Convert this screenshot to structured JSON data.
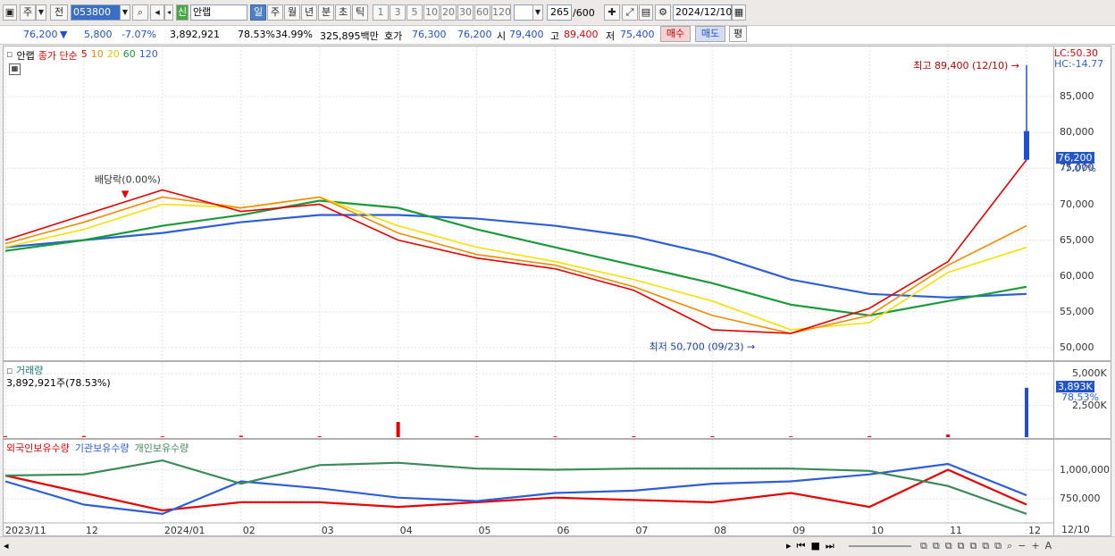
{
  "toolbar": {
    "market": "주",
    "mode": "전",
    "code": "053800",
    "badge": "신",
    "name": "안랩",
    "periods": [
      "일",
      "주",
      "월",
      "년",
      "분",
      "초",
      "틱"
    ],
    "selected_period": "일",
    "intervals": [
      "1",
      "3",
      "5",
      "10",
      "20",
      "30",
      "60",
      "120"
    ],
    "count": "265",
    "count_max": "/600",
    "date": "2024/12/10"
  },
  "quote": {
    "price": "76,200",
    "change": "5,800",
    "change_pct": "-7.07%",
    "volume": "3,892,921",
    "vol_ratio": "78.53%",
    "rate2": "34.99%",
    "amount": "325,895백만",
    "ask_label": "호가",
    "ask": "76,300",
    "bid": "76,200",
    "open_label": "시",
    "open": "79,400",
    "high_label": "고",
    "high": "89,400",
    "low_label": "저",
    "low": "75,400",
    "buy_button": "매수",
    "sell_button": "매도",
    "eval_button": "평"
  },
  "colors": {
    "up": "#e60000",
    "down": "#1f4fd6",
    "ma5": "#e60000",
    "ma10": "#f08c00",
    "ma20": "#f5e100",
    "ma60": "#1b9a3a",
    "ma120": "#2d5ed8",
    "foreign": "#e60000",
    "institution": "#2d5ed8",
    "individual": "#3a8a5a"
  },
  "price_panel": {
    "stock_label": "안랩",
    "legend_prefix": "종가 단순",
    "ma_labels": [
      "5",
      "10",
      "20",
      "60",
      "120"
    ],
    "high_marker": "최고 89,400 (12/10)",
    "low_marker": "최저 50,700 (09/23)",
    "dividend_marker": "배당락(0.00%)",
    "lc": "LC:50.30",
    "hc": "HC:-14.77",
    "last_price": "76,200",
    "last_pct": "-7.07%"
  },
  "volume_panel": {
    "title": "거래량",
    "value": "3,892,921주(78.53%)",
    "last_value": "3,893K",
    "last_pct": "78.53%"
  },
  "flow_panel": {
    "series_labels": [
      "외국인보유수량",
      "기관보유수량",
      "개인보유수량"
    ]
  },
  "chart_data": [
    {
      "type": "line",
      "title": "",
      "x": [
        "2023-11",
        "2023-12",
        "2024-01",
        "2024-02",
        "2024-03",
        "2024-04",
        "2024-05",
        "2024-06",
        "2024-07",
        "2024-08",
        "2024-09",
        "2024-10",
        "2024-11",
        "2024-12-10"
      ],
      "ylim": [
        49000,
        91000
      ],
      "y_ticks": [
        50000,
        55000,
        60000,
        65000,
        70000,
        75000,
        80000,
        85000
      ],
      "y_tick_labels": [
        "50,000",
        "55,000",
        "60,000",
        "65,000",
        "70,000",
        "75,000",
        "80,000",
        "85,000"
      ],
      "series": [
        {
          "name": "5",
          "values": [
            65000,
            68500,
            72000,
            69000,
            70000,
            65000,
            62500,
            61000,
            58000,
            52500,
            52000,
            55500,
            62000,
            76200
          ]
        },
        {
          "name": "10",
          "values": [
            64500,
            67500,
            71000,
            69500,
            71000,
            66000,
            63000,
            61500,
            58500,
            54500,
            52000,
            54500,
            61500,
            67000
          ]
        },
        {
          "name": "20",
          "values": [
            64000,
            66500,
            70000,
            69500,
            71000,
            67000,
            64000,
            62000,
            59500,
            56500,
            52500,
            53500,
            60500,
            64000
          ]
        },
        {
          "name": "60",
          "values": [
            63500,
            65000,
            67000,
            68500,
            70500,
            69500,
            66500,
            64000,
            61500,
            59000,
            56000,
            54500,
            56500,
            58500
          ]
        },
        {
          "name": "120",
          "values": [
            64000,
            65000,
            66000,
            67500,
            68500,
            68500,
            68000,
            67000,
            65500,
            63000,
            59500,
            57500,
            57000,
            57500
          ]
        }
      ],
      "high": {
        "value": 89400,
        "date": "12/10"
      },
      "low": {
        "value": 50700,
        "date": "09/23"
      },
      "last": 76200
    },
    {
      "type": "bar",
      "title": "거래량",
      "ylim": [
        0,
        5500
      ],
      "y_ticks": [
        2500,
        5000
      ],
      "y_tick_labels": [
        "2,500K",
        "5,000K"
      ],
      "x": [
        "2023-11",
        "2023-12",
        "2024-01",
        "2024-02",
        "2024-03",
        "2024-04",
        "2024-05",
        "2024-06",
        "2024-07",
        "2024-08",
        "2024-09",
        "2024-10",
        "2024-11",
        "2024-12-10"
      ],
      "values": [
        80,
        90,
        60,
        110,
        70,
        1200,
        80,
        60,
        70,
        70,
        60,
        80,
        200,
        3893
      ]
    },
    {
      "type": "line",
      "ylim": [
        550000,
        1150000
      ],
      "y_ticks": [
        750000,
        1000000
      ],
      "y_tick_labels": [
        "750,000",
        "1,000,000"
      ],
      "x_tick_labels": [
        "2023/11",
        "12",
        "2024/01",
        "02",
        "03",
        "04",
        "05",
        "06",
        "07",
        "08",
        "09",
        "10",
        "11",
        "12",
        "12/10"
      ],
      "series": [
        {
          "name": "외국인보유수량",
          "values": [
            950000,
            800000,
            650000,
            720000,
            720000,
            680000,
            720000,
            760000,
            740000,
            720000,
            800000,
            680000,
            1000000,
            700000
          ]
        },
        {
          "name": "기관보유수량",
          "values": [
            900000,
            700000,
            620000,
            900000,
            840000,
            760000,
            730000,
            800000,
            820000,
            880000,
            900000,
            960000,
            1050000,
            780000
          ]
        },
        {
          "name": "개인보유수량",
          "values": [
            950000,
            960000,
            1080000,
            880000,
            1040000,
            1060000,
            1010000,
            1000000,
            1010000,
            1010000,
            1010000,
            990000,
            860000,
            620000
          ]
        }
      ]
    }
  ]
}
